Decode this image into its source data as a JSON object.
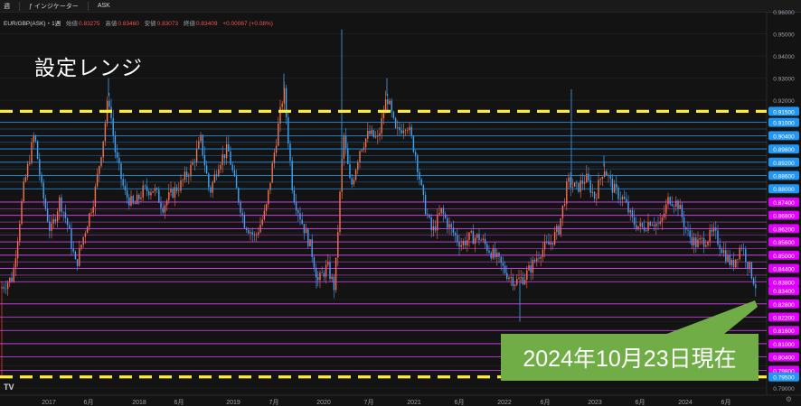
{
  "toolbar": {
    "timeframe": "週",
    "indicators_label": "インジケーター",
    "price_side": "ASK"
  },
  "legend": {
    "symbol": "EUR/GBP(ASK)・1週",
    "open_label": "始値",
    "open": "0.83275",
    "high_label": "高値",
    "high": "0.83460",
    "low_label": "安値",
    "low": "0.83073",
    "close_label": "終値",
    "close": "0.83409",
    "change": "+0.00067 (+0.08%)"
  },
  "annotations": {
    "setting_label": "設定レンジ",
    "status_box": "2024年10月23日現在",
    "status_box_color": "#70ad47"
  },
  "colors": {
    "background": "#131313",
    "bull": "#ff7043",
    "bear": "#42a5f5",
    "range_yellow": "#ffeb3b",
    "blue_line": "#2196f3",
    "magenta_line": "#e040fb",
    "magenta_label": "#e100ff",
    "blue_label": "#2196f3"
  },
  "chart_data": {
    "type": "candlestick",
    "title": "EUR/GBP(ASK)・1週",
    "ylim": [
      0.79,
      0.96
    ],
    "y_axis_ticks": [
      "0.96000",
      "0.95000",
      "0.94000",
      "0.93000",
      "0.92000",
      "0.91000",
      "0.90000",
      "0.89000",
      "0.88000",
      "0.87000",
      "0.86000",
      "0.85000",
      "0.84000",
      "0.83000",
      "0.82000",
      "0.81000",
      "0.80000",
      "0.79000"
    ],
    "x_axis_ticks": [
      "2017",
      "6月",
      "2018",
      "6月",
      "2019",
      "7月",
      "2020",
      "7月",
      "2021",
      "6月",
      "2022",
      "6月",
      "2023",
      "6月",
      "2024",
      "6月"
    ],
    "range_lines": [
      {
        "price": 0.915,
        "label": "0.91500",
        "style": "dashed-yellow"
      },
      {
        "price": 0.795,
        "label": "0.79500",
        "style": "dashed-yellow"
      }
    ],
    "blue_levels": [
      "0.91000",
      "0.90400",
      "0.89800",
      "0.89200",
      "0.88600",
      "0.88000"
    ],
    "magenta_levels": [
      "0.87400",
      "0.86800",
      "0.86200",
      "0.85600",
      "0.85000",
      "0.84400",
      "0.83800",
      "0.82800",
      "0.82200",
      "0.81600",
      "0.81000",
      "0.80400",
      "0.79800"
    ],
    "price_path": [
      [
        0,
        0.835
      ],
      [
        14,
        0.84
      ],
      [
        26,
        0.88
      ],
      [
        38,
        0.905
      ],
      [
        46,
        0.88
      ],
      [
        56,
        0.86
      ],
      [
        66,
        0.875
      ],
      [
        74,
        0.865
      ],
      [
        84,
        0.845
      ],
      [
        92,
        0.858
      ],
      [
        104,
        0.876
      ],
      [
        114,
        0.902
      ],
      [
        120,
        0.922
      ],
      [
        128,
        0.895
      ],
      [
        138,
        0.878
      ],
      [
        148,
        0.872
      ],
      [
        158,
        0.879
      ],
      [
        170,
        0.88
      ],
      [
        180,
        0.872
      ],
      [
        190,
        0.878
      ],
      [
        200,
        0.882
      ],
      [
        212,
        0.89
      ],
      [
        222,
        0.902
      ],
      [
        232,
        0.878
      ],
      [
        242,
        0.892
      ],
      [
        252,
        0.898
      ],
      [
        260,
        0.882
      ],
      [
        270,
        0.865
      ],
      [
        282,
        0.858
      ],
      [
        294,
        0.87
      ],
      [
        304,
        0.898
      ],
      [
        314,
        0.925
      ],
      [
        324,
        0.878
      ],
      [
        334,
        0.865
      ],
      [
        344,
        0.853
      ],
      [
        352,
        0.838
      ],
      [
        362,
        0.845
      ],
      [
        370,
        0.835
      ],
      [
        380,
        0.905
      ],
      [
        388,
        0.88
      ],
      [
        398,
        0.898
      ],
      [
        408,
        0.905
      ],
      [
        418,
        0.902
      ],
      [
        428,
        0.922
      ],
      [
        438,
        0.905
      ],
      [
        450,
        0.91
      ],
      [
        460,
        0.895
      ],
      [
        468,
        0.875
      ],
      [
        478,
        0.86
      ],
      [
        488,
        0.87
      ],
      [
        498,
        0.862
      ],
      [
        510,
        0.855
      ],
      [
        520,
        0.858
      ],
      [
        530,
        0.858
      ],
      [
        540,
        0.853
      ],
      [
        550,
        0.848
      ],
      [
        560,
        0.842
      ],
      [
        570,
        0.838
      ],
      [
        580,
        0.84
      ],
      [
        588,
        0.845
      ],
      [
        598,
        0.852
      ],
      [
        608,
        0.855
      ],
      [
        618,
        0.862
      ],
      [
        628,
        0.883
      ],
      [
        638,
        0.88
      ],
      [
        648,
        0.885
      ],
      [
        658,
        0.876
      ],
      [
        668,
        0.89
      ],
      [
        678,
        0.88
      ],
      [
        690,
        0.875
      ],
      [
        700,
        0.865
      ],
      [
        710,
        0.862
      ],
      [
        720,
        0.866
      ],
      [
        730,
        0.863
      ],
      [
        740,
        0.876
      ],
      [
        750,
        0.873
      ],
      [
        760,
        0.86
      ],
      [
        770,
        0.855
      ],
      [
        780,
        0.857
      ],
      [
        790,
        0.86
      ],
      [
        800,
        0.852
      ],
      [
        810,
        0.845
      ],
      [
        820,
        0.855
      ],
      [
        830,
        0.843
      ],
      [
        838,
        0.834
      ]
    ]
  }
}
